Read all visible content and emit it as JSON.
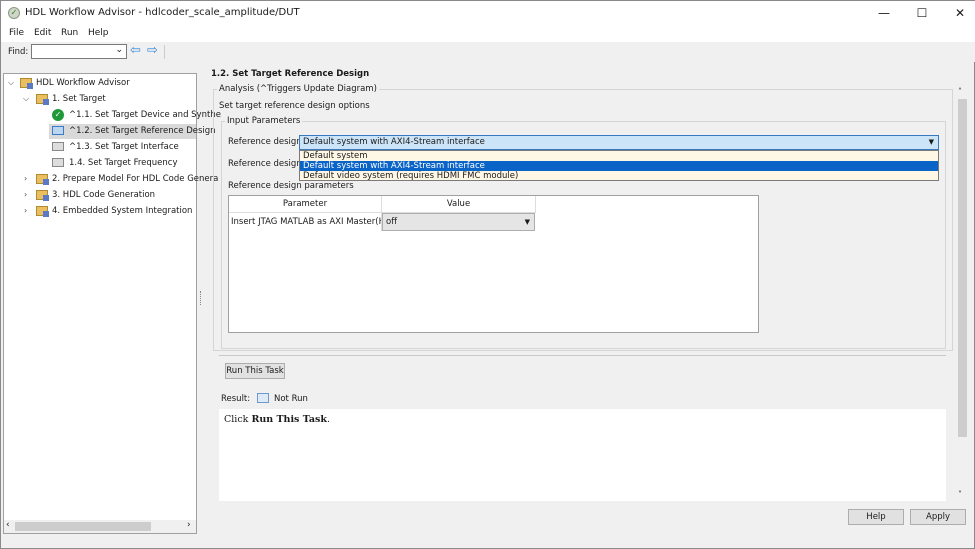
{
  "window": {
    "title": "HDL Workflow Advisor - hdlcoder_scale_amplitude/DUT",
    "minimize": "—",
    "maximize": "☐",
    "close": "✕"
  },
  "menu": [
    "File",
    "Edit",
    "Run",
    "Help"
  ],
  "toolbar": {
    "find_label": "Find:",
    "find_value": "",
    "back": "⇦",
    "forward": "⇨"
  },
  "tree": {
    "root": "HDL Workflow Advisor",
    "items": [
      {
        "label": "1. Set Target",
        "expanded": true,
        "children": [
          {
            "label": "^1.1. Set Target Device and Synthe",
            "status": "passed"
          },
          {
            "label": "^1.2. Set Target Reference Design",
            "status": "selected"
          },
          {
            "label": "^1.3. Set Target Interface",
            "status": "not-run"
          },
          {
            "label": "1.4. Set Target Frequency",
            "status": "not-run"
          }
        ]
      },
      {
        "label": "2. Prepare Model For HDL Code Genera"
      },
      {
        "label": "3. HDL Code Generation"
      },
      {
        "label": "4. Embedded System Integration"
      }
    ]
  },
  "main": {
    "heading": "1.2. Set Target Reference Design",
    "analysis_legend": "Analysis (^Triggers Update Diagram)",
    "description": "Set target reference design options",
    "input_legend": "Input Parameters",
    "ref_design_label": "Reference design:",
    "ref_design_value": "Default system with AXI4-Stream interface",
    "ref_design_options": [
      "Default system",
      "Default system with AXI4-Stream interface",
      "Default video system (requires HDMI FMC module)"
    ],
    "ref_tool_label": "Reference design tool version:",
    "params_label": "Reference design parameters",
    "table": {
      "headers": [
        "Parameter",
        "Value"
      ],
      "rows": [
        {
          "param": "Insert JTAG MATLAB as AXI Master(H...",
          "value": "off"
        }
      ]
    },
    "run_button": "Run This Task",
    "result_label": "Result:",
    "result_value": "Not Run",
    "output_prefix": "Click ",
    "output_bold": "Run This Task",
    "output_suffix": "."
  },
  "footer": {
    "help": "Help",
    "apply": "Apply"
  },
  "colors": {
    "selection": "#0a64c8",
    "combo": "#cce4f7",
    "dropdown_bg": "#fff7e6"
  }
}
